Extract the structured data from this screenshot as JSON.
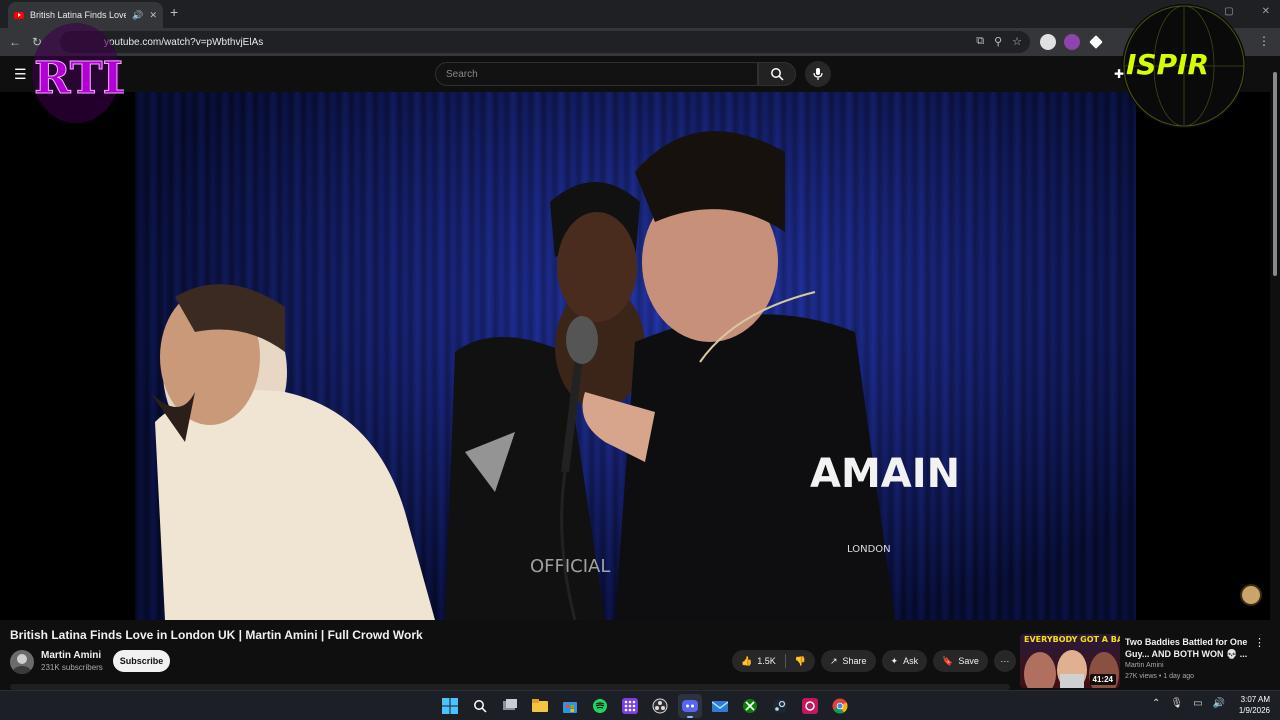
{
  "browser": {
    "tab_title": "British Latina Finds Love in Lo",
    "url": "youtube.com/watch?v=pWbthvjElAs"
  },
  "youtube": {
    "search_placeholder": "Search"
  },
  "video": {
    "title": "British Latina Finds Love in London UK | Martin Amini | Full Crowd Work",
    "channel": "Martin Amini",
    "subscribers": "231K subscribers",
    "subscribe_label": "Subscribe",
    "likes": "1.5K",
    "share_label": "Share",
    "ask_label": "Ask",
    "save_label": "Save",
    "shirt_text": "AMAIN",
    "shirt_small": "LONDON"
  },
  "recommendation": {
    "thumb_text": "EVERYBODY GOT A BADDIE",
    "duration": "41:24",
    "title": "Two Baddies Battled for One Guy... AND BOTH WON 💀 ...",
    "channel": "Martin Amini",
    "meta": "27K views • 1 day ago"
  },
  "overlay": {
    "left_logo": "RTL",
    "right_logo": "ISPIR"
  },
  "taskbar": {
    "time": "3:07 AM",
    "date": "1/9/2026"
  }
}
